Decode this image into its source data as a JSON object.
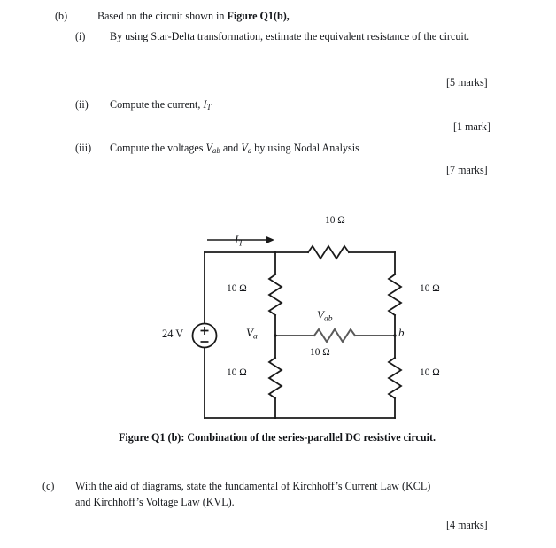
{
  "document": {
    "parts": [
      {
        "letter": "(b)",
        "stem_prefix": "Based on the circuit shown in ",
        "stem_bold": "Figure Q1(b),",
        "subparts": [
          {
            "numeral": "(i)",
            "text": "By using Star-Delta transformation, estimate the equivalent resistance of the circuit.",
            "marks": "[5 marks]"
          },
          {
            "numeral": "(ii)",
            "text_prefix": "Compute the current, ",
            "symbol": "I",
            "symbol_sub": "T",
            "marks": "[1 mark]"
          },
          {
            "numeral": "(iii)",
            "text_prefix": "Compute the voltages ",
            "symbol1": "V",
            "symbol1_sub": "ab",
            "text_mid": " and ",
            "symbol2": "V",
            "symbol2_sub": "a",
            "text_suffix": " by using Nodal Analysis",
            "marks": "[7 marks]"
          }
        ]
      },
      {
        "letter": "(c)",
        "line1": "With the aid of diagrams, state the fundamental of Kirchhoff’s Current Law (KCL)",
        "line2": "and Kirchhoff’s Voltage Law (KVL).",
        "marks": "[4 marks]"
      }
    ],
    "figure": {
      "caption": "Figure Q1 (b): Combination of the series-parallel DC resistive circuit.",
      "source_label": "24 V",
      "source_polarity_plus": "+",
      "source_polarity_minus": "−",
      "current_label": "I",
      "current_label_sub": "T",
      "node_a_label": "V",
      "node_a_sub": "a",
      "node_b_label": "b",
      "bridge_voltage_label": "V",
      "bridge_voltage_sub": "ab",
      "resistors": [
        {
          "id": "R-top",
          "value": "10 Ω"
        },
        {
          "id": "R-left-upper",
          "value": "10 Ω"
        },
        {
          "id": "R-left-lower",
          "value": "10 Ω"
        },
        {
          "id": "R-right-upper",
          "value": "10 Ω"
        },
        {
          "id": "R-right-lower",
          "value": "10 Ω"
        },
        {
          "id": "R-bridge",
          "value": "10 Ω"
        }
      ]
    }
  },
  "colors": {
    "ink": "#16181c",
    "wire": "#1a1a1a",
    "bridge_wire": "#555555",
    "page_background": "#ffffff"
  }
}
